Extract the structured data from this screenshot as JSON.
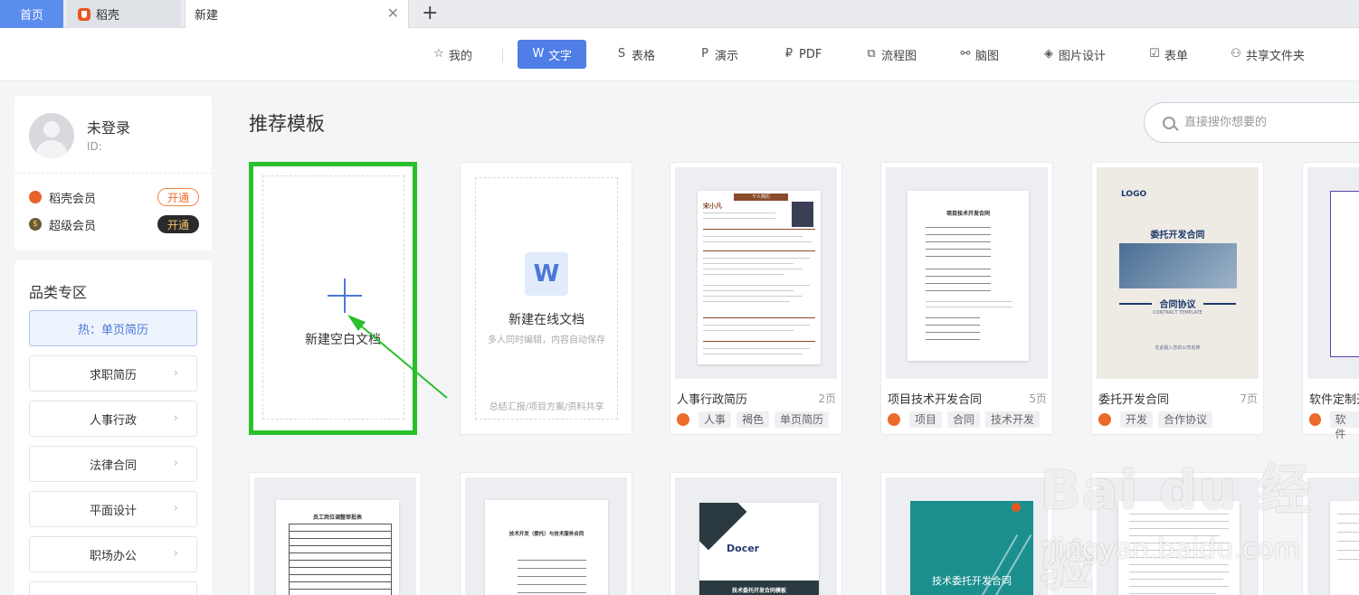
{
  "tabs": {
    "home": "首页",
    "daoke": "稻壳",
    "new": "新建"
  },
  "toolbar": {
    "items": [
      {
        "label": "我的",
        "icon": "star-icon"
      },
      {
        "label": "文字",
        "icon": "w-icon",
        "active": true
      },
      {
        "label": "表格",
        "icon": "s-icon"
      },
      {
        "label": "演示",
        "icon": "p-icon"
      },
      {
        "label": "PDF",
        "icon": "pdf-icon"
      },
      {
        "label": "流程图",
        "icon": "flowchart-icon"
      },
      {
        "label": "脑图",
        "icon": "mindmap-icon"
      },
      {
        "label": "图片设计",
        "icon": "image-design-icon"
      },
      {
        "label": "表单",
        "icon": "form-icon"
      },
      {
        "label": "共享文件夹",
        "icon": "share-folder-icon"
      }
    ]
  },
  "user": {
    "name": "未登录",
    "id_label": "ID:",
    "members": [
      {
        "label": "稻壳会员",
        "button": "开通"
      },
      {
        "label": "超级会员",
        "button": "开通"
      }
    ]
  },
  "categories": {
    "title": "品类专区",
    "hot": "热：单页简历",
    "items": [
      "求职简历",
      "人事行政",
      "法律合同",
      "平面设计",
      "职场办公"
    ]
  },
  "main": {
    "title": "推荐模板",
    "search_placeholder": "直接搜你想要的",
    "blank": {
      "label": "新建空白文档"
    },
    "online": {
      "title": "新建在线文档",
      "subtitle": "多人同时编辑，内容自动保存",
      "footer": "总结汇报/项目方案/资料共享"
    },
    "templates": [
      {
        "name": "人事行政简历",
        "pages": "2页",
        "tags": [
          "人事",
          "褐色",
          "单页简历"
        ]
      },
      {
        "name": "项目技术开发合同",
        "pages": "5页",
        "tags": [
          "项目",
          "合同",
          "技术开发"
        ]
      },
      {
        "name": "委托开发合同",
        "pages": "7页",
        "tags": [
          "开发",
          "合作协议"
        ]
      },
      {
        "name": "软件定制开",
        "pages": "",
        "tags": [
          "软件"
        ]
      }
    ],
    "thumbs": {
      "resume_title": "个人简历",
      "resume_name": "宋小凡",
      "contract_title": "项目技术开发合同",
      "wt_logo": "LOGO",
      "wt_title": "委托开发合同",
      "wt_sub": "合同协议",
      "wt_en": "CONTRACT TEMPLATE",
      "wt_foot": "在此输入您的公司名称",
      "r2_1": "员工岗位调整审批表",
      "r2_2": "技术开发（委托）与技术服务合同",
      "r2_3": "技术委托开发合同模板",
      "r2_3_brand": "Docer",
      "r2_4": "技术委托开发合同"
    }
  },
  "watermark": {
    "main": "Bai du 经验",
    "sub": "jingyan.baidu.com"
  }
}
